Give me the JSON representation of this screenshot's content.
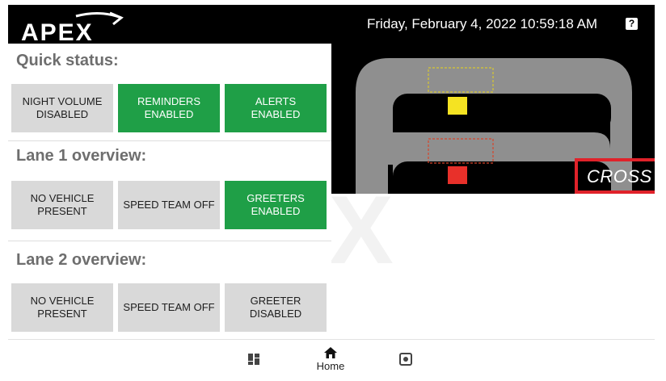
{
  "brand": {
    "name": "APEX"
  },
  "header": {
    "datetime": "Friday, February 4, 2022 10:59:18 AM",
    "help_icon": "help-icon",
    "help_glyph": "?"
  },
  "quick_status": {
    "title": "Quick status:",
    "tiles": [
      {
        "label": "NIGHT VOLUME DISABLED",
        "state": "off"
      },
      {
        "label": "REMINDERS ENABLED",
        "state": "on"
      },
      {
        "label": "ALERTS ENABLED",
        "state": "on"
      }
    ]
  },
  "lane1": {
    "title": "Lane 1 overview:",
    "tiles": [
      {
        "label": "NO VEHICLE PRESENT",
        "state": "off"
      },
      {
        "label": "SPEED TEAM OFF",
        "state": "off"
      },
      {
        "label": "GREETERS ENABLED",
        "state": "on"
      }
    ]
  },
  "lane2": {
    "title": "Lane 2 overview:",
    "tiles": [
      {
        "label": "NO VEHICLE PRESENT",
        "state": "off"
      },
      {
        "label": "SPEED TEAM OFF",
        "state": "off"
      },
      {
        "label": "GREETER DISABLED",
        "state": "off"
      }
    ]
  },
  "map": {
    "cross_label": "CROSS",
    "lane1_marker_color": "#f5e322",
    "lane2_marker_color": "#e8302a"
  },
  "nav": {
    "items": [
      {
        "icon": "dashboard-icon"
      },
      {
        "icon": "home-icon",
        "label": "Home"
      },
      {
        "icon": "settings-icon"
      }
    ]
  },
  "colors": {
    "enabled": "#1f9f47",
    "disabled": "#d9d9d9",
    "highlight": "#e0222a"
  }
}
